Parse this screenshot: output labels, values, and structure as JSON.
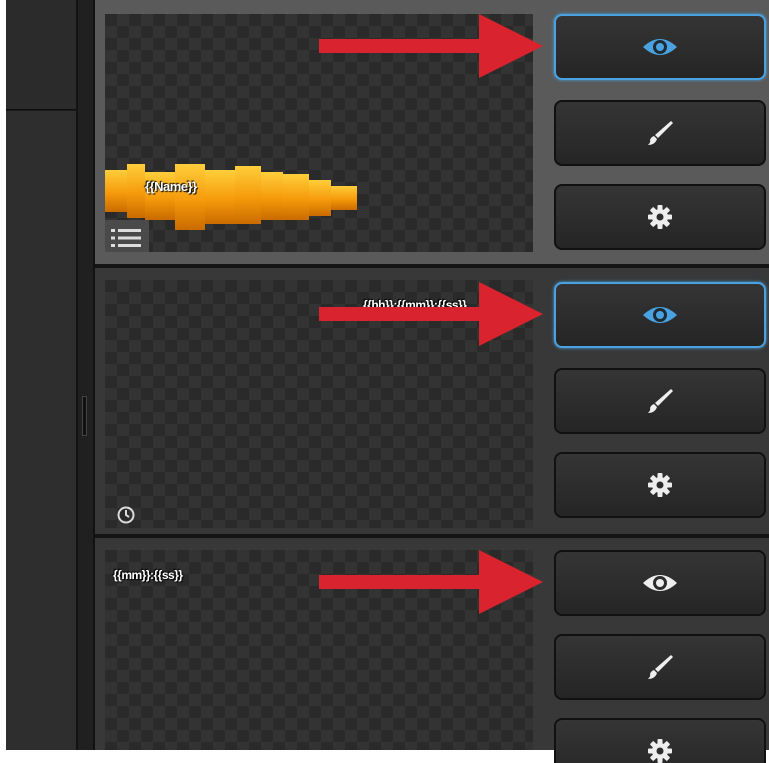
{
  "layers": [
    {
      "type": "lower-third",
      "preview_text": "{{Name}}",
      "indicator_icon": "list-icon",
      "buttons": [
        "eye-icon",
        "brush-icon",
        "gear-icon"
      ],
      "active_button": "eye-icon"
    },
    {
      "type": "clock",
      "preview_text": "{{hh}}:{{mm}}:{{ss}}",
      "indicator_icon": "clock-icon",
      "buttons": [
        "eye-icon",
        "brush-icon",
        "gear-icon"
      ],
      "active_button": "eye-icon"
    },
    {
      "type": "clock",
      "preview_text": "{{mm}}:{{ss}}",
      "indicator_icon": "clock-icon",
      "buttons": [
        "eye-icon",
        "brush-icon",
        "gear-icon"
      ],
      "active_button": null
    }
  ],
  "colors": {
    "annotation_arrow": "#d9232e",
    "active_border": "#4aa3e0",
    "eye_icon": "#4aa3e0",
    "bar_gradient": "#f59a0b"
  }
}
